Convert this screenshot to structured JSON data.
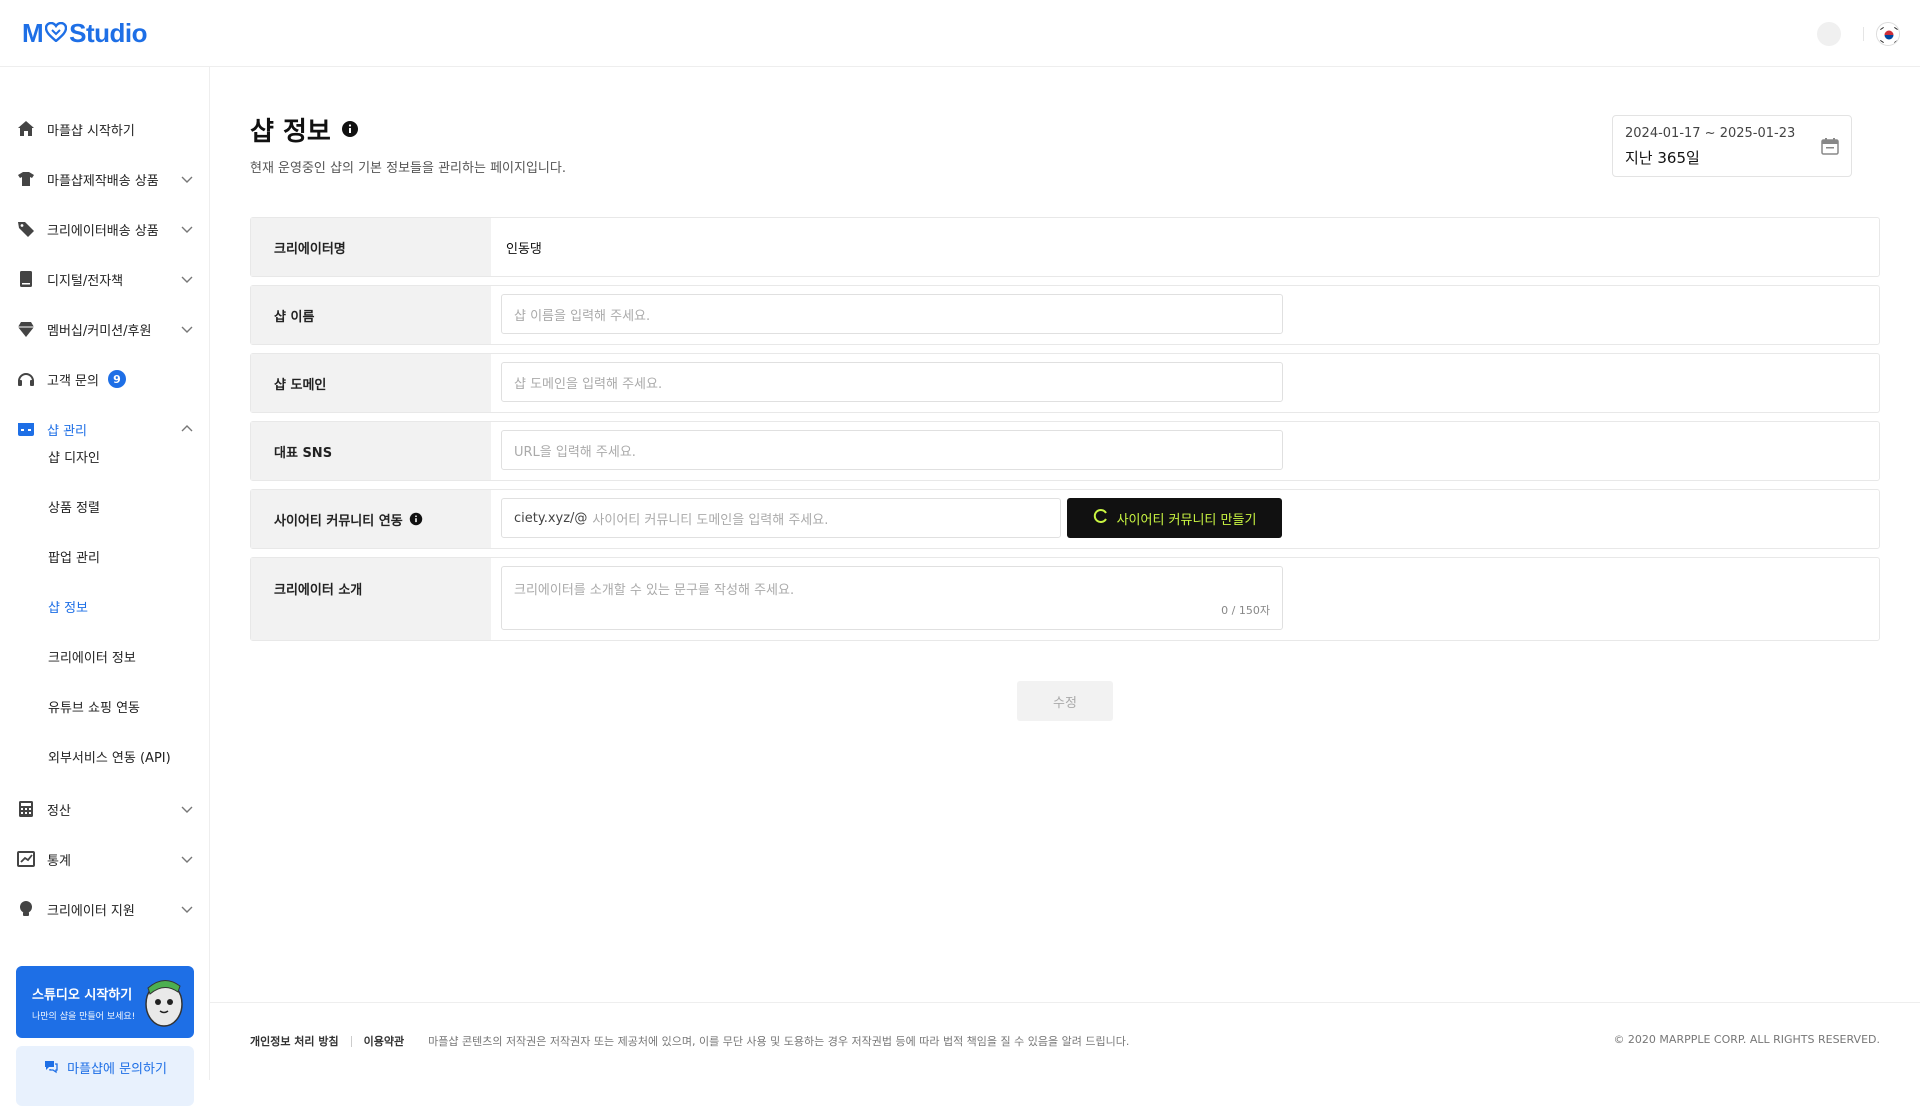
{
  "app": {
    "logo_left": "M",
    "logo_right": "Studio",
    "brand_color": "#1e6fe6"
  },
  "sidebar": {
    "items": [
      {
        "label": "마플샵 시작하기",
        "icon": "home-icon"
      },
      {
        "label": "마플샵제작배송 상품",
        "icon": "tshirt-icon"
      },
      {
        "label": "크리에이터배송 상품",
        "icon": "tag-icon"
      },
      {
        "label": "디지털/전자책",
        "icon": "book-icon"
      },
      {
        "label": "멤버십/커미션/후원",
        "icon": "gem-icon"
      },
      {
        "label": "고객 문의",
        "icon": "headset-icon",
        "badge": "9"
      },
      {
        "label": "샵 관리",
        "icon": "store-icon"
      },
      {
        "label": "정산",
        "icon": "calculator-icon"
      },
      {
        "label": "통계",
        "icon": "chart-icon"
      },
      {
        "label": "크리에이터 지원",
        "icon": "bulb-icon"
      }
    ],
    "sub_items": [
      {
        "label": "샵 디자인"
      },
      {
        "label": "상품 정렬"
      },
      {
        "label": "팝업 관리"
      },
      {
        "label": "샵 정보"
      },
      {
        "label": "크리에이터 정보"
      },
      {
        "label": "유튜브 쇼핑 연동"
      },
      {
        "label": "외부서비스 연동 (API)"
      }
    ],
    "promo": {
      "title": "스튜디오 시작하기",
      "subtitle": "나만의 샵을 만들어 보세요!"
    },
    "contact_label": "마플샵에 문의하기"
  },
  "page": {
    "title": "샵 정보",
    "description": "현재 운영중인 샵의 기본 정보들을 관리하는 페이지입니다.",
    "date_range": "2024-01-17 ~ 2025-01-23",
    "period": "지난 365일"
  },
  "form": {
    "creator_name_label": "크리에이터명",
    "creator_name_value": "인동댕",
    "shop_name_label": "샵 이름",
    "shop_name_placeholder": "샵 이름을 입력해 주세요.",
    "shop_domain_label": "샵 도메인",
    "shop_domain_placeholder": "샵 도메인을 입력해 주세요.",
    "sns_label": "대표 SNS",
    "sns_placeholder": "URL을 입력해 주세요.",
    "ciety_label": "사이어티 커뮤니티 연동",
    "ciety_prefix": "ciety.xyz/@",
    "ciety_placeholder": "사이어티 커뮤니티 도메인을 입력해 주세요.",
    "ciety_button": "사이어티 커뮤니티 만들기",
    "intro_label": "크리에이터 소개",
    "intro_placeholder": "크리에이터를 소개할 수 있는 문구를 작성해 주세요.",
    "intro_count": "0 / 150자",
    "submit_label": "수정"
  },
  "footer": {
    "privacy": "개인정보 처리 방침",
    "terms": "이용약관",
    "notice": "마플샵 콘텐츠의 저작권은 저작권자 또는 제공처에 있으며, 이를 무단 사용 및 도용하는 경우 저작권법 등에 따라 법적 책임을 질 수 있음을 알려 드립니다.",
    "copyright": "© 2020 MARPPLE CORP. ALL RIGHTS RESERVED."
  }
}
